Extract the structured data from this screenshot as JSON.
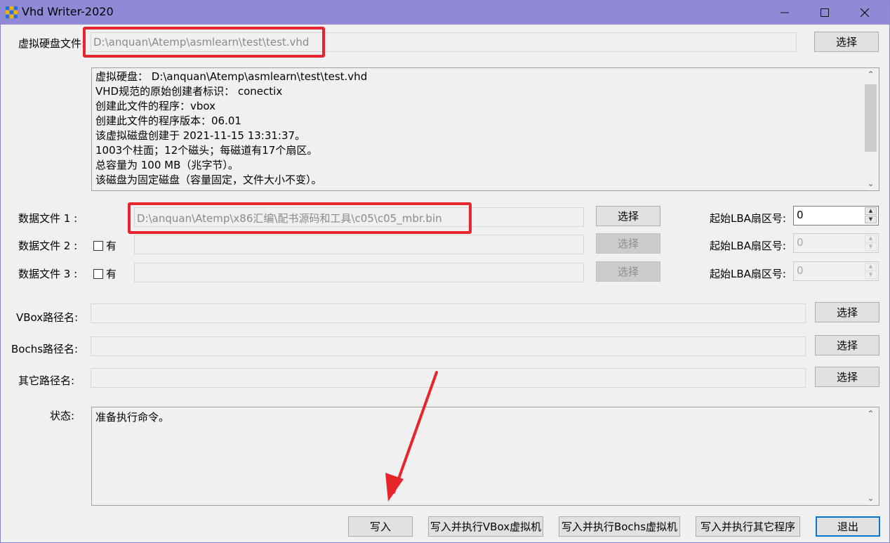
{
  "window": {
    "title": "Vhd Writer-2020"
  },
  "vhd": {
    "label": "虚拟硬盘文件:",
    "path": "D:\\anquan\\Atemp\\asmlearn\\test\\test.vhd",
    "select": "选择"
  },
  "info_lines": [
    "虚拟硬盘：  D:\\anquan\\Atemp\\asmlearn\\test\\test.vhd",
    "VHD规范的原始创建者标识：  conectix",
    "创建此文件的程序：vbox",
    "创建此文件的程序版本：06.01",
    "该虚拟磁盘创建于 2021-11-15 13:31:37。",
    "1003个柱面；12个磁头；每磁道有17个扇区。",
    "总容量为 100 MB（兆字节）。",
    "该磁盘为固定磁盘（容量固定，文件大小不变）。"
  ],
  "data_files": [
    {
      "label": "数据文件 1 :",
      "checkbox": "",
      "path": "D:\\anquan\\Atemp\\x86汇编\\配书源码和工具\\c05\\c05_mbr.bin",
      "select": "选择",
      "lba_label": "起始LBA扇区号:",
      "lba": "0"
    },
    {
      "label": "数据文件 2 :",
      "checkbox": "有",
      "path": "",
      "select": "选择",
      "lba_label": "起始LBA扇区号:",
      "lba": "0"
    },
    {
      "label": "数据文件 3 :",
      "checkbox": "有",
      "path": "",
      "select": "选择",
      "lba_label": "起始LBA扇区号:",
      "lba": "0"
    }
  ],
  "paths": [
    {
      "label": "VBox路径名:",
      "value": "",
      "select": "选择"
    },
    {
      "label": "Bochs路径名:",
      "value": "",
      "select": "选择"
    },
    {
      "label": "其它路径名:",
      "value": "",
      "select": "选择"
    }
  ],
  "status": {
    "label": "状态:",
    "text": "准备执行命令。"
  },
  "buttons": {
    "write": "写入",
    "write_vbox": "写入并执行VBox虚拟机",
    "write_bochs": "写入并执行Bochs虚拟机",
    "write_other": "写入并执行其它程序",
    "exit": "退出"
  },
  "colors": {
    "titlebar": "#8f89d6",
    "highlight": "#e8242c",
    "accent": "#0078d7"
  }
}
